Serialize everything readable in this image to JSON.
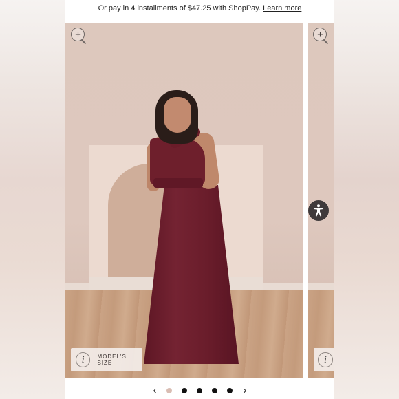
{
  "promo": {
    "text": "Or pay in 4 installments of $47.25 with ShopPay.",
    "link": "Learn more"
  },
  "gallery": {
    "model_size_label": "MODEL'S SIZE",
    "info_glyph": "i",
    "zoom_glyph": "+",
    "carousel": {
      "prev_glyph": "‹",
      "next_glyph": "›",
      "dot_count": 5,
      "active_index": 0,
      "active_color": "#d9bdb3",
      "inactive_color": "#111111"
    }
  },
  "icons": {
    "zoom": "zoom-in-icon",
    "info": "info-icon",
    "accessibility": "accessibility-icon",
    "prev": "chevron-left-icon",
    "next": "chevron-right-icon"
  },
  "colors": {
    "dress": "#6e1f2c",
    "backdrop": "#ddc8bd",
    "accessibility_button": "#3f3a3b"
  }
}
